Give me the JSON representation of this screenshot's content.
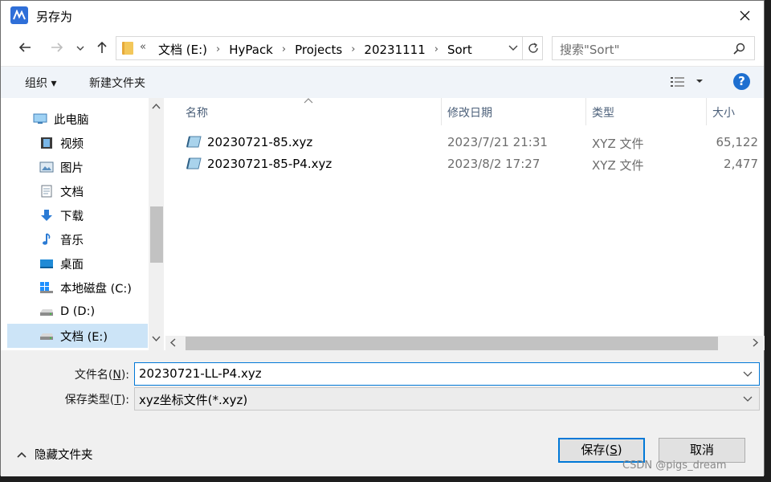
{
  "window": {
    "title": "另存为"
  },
  "nav": {
    "overflow_chevrons": "«",
    "breadcrumbs": [
      "文档 (E:)",
      "HyPack",
      "Projects",
      "20231111",
      "Sort"
    ],
    "search_placeholder": "搜索\"Sort\""
  },
  "toolbar": {
    "organize_label": "组织 ▾",
    "new_folder_label": "新建文件夹",
    "help_label": "?"
  },
  "sidebar": {
    "items": [
      {
        "label": "此电脑",
        "icon": "pc-icon"
      },
      {
        "label": "视频",
        "icon": "video-icon"
      },
      {
        "label": "图片",
        "icon": "picture-icon"
      },
      {
        "label": "文档",
        "icon": "document-icon"
      },
      {
        "label": "下载",
        "icon": "download-icon"
      },
      {
        "label": "音乐",
        "icon": "music-icon"
      },
      {
        "label": "桌面",
        "icon": "desktop-icon"
      },
      {
        "label": "本地磁盘 (C:)",
        "icon": "drive-c-icon"
      },
      {
        "label": "D (D:)",
        "icon": "drive-icon"
      },
      {
        "label": "文档 (E:)",
        "icon": "drive-icon",
        "selected": true
      }
    ]
  },
  "filelist": {
    "columns": [
      "名称",
      "修改日期",
      "类型",
      "大小"
    ],
    "rows": [
      {
        "name": "20230721-85.xyz",
        "date": "2023/7/21 21:31",
        "type": "XYZ 文件",
        "size": "65,122"
      },
      {
        "name": "20230721-85-P4.xyz",
        "date": "2023/8/2 17:27",
        "type": "XYZ 文件",
        "size": "2,477"
      }
    ]
  },
  "bottom": {
    "filename_label": "文件名(",
    "filename_key": "N",
    "filename_label_end": "):",
    "filename_value": "20230721-LL-P4.xyz",
    "filetype_label": "保存类型(",
    "filetype_key": "T",
    "filetype_label_end": "):",
    "filetype_value": "xyz坐标文件(*.xyz)",
    "hide_folders_label": "隐藏文件夹",
    "save_label_pre": "保存(",
    "save_key": "S",
    "save_label_post": ")",
    "cancel_label": "取消"
  },
  "watermark": "CSDN @pigs_dream"
}
